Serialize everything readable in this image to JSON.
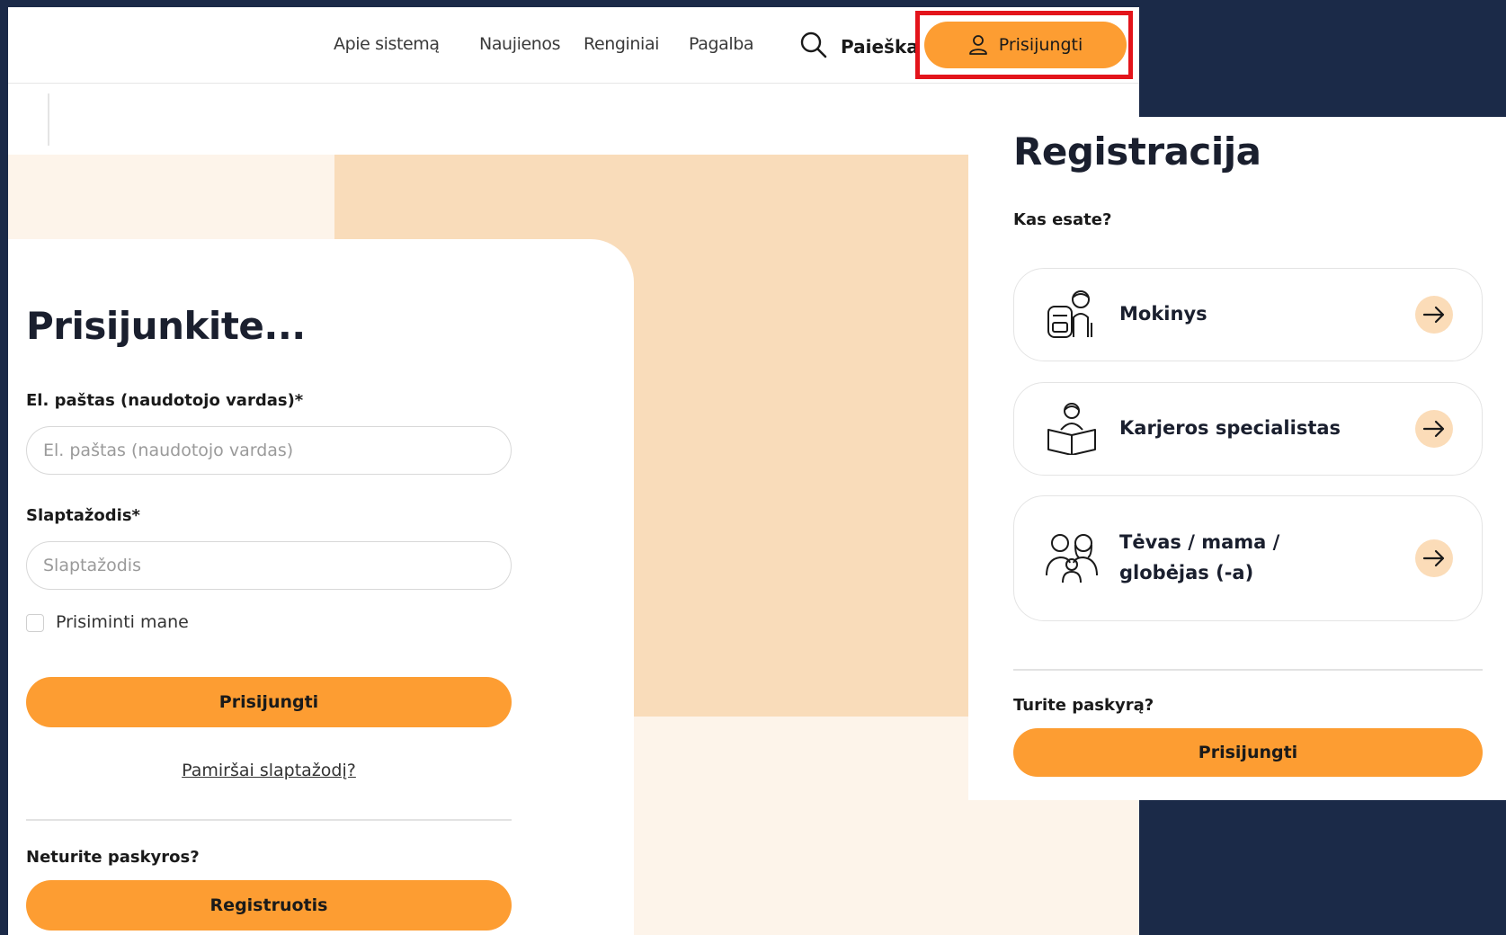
{
  "nav": {
    "links": [
      "Apie sistemą",
      "Naujienos",
      "Renginiai",
      "Pagalba"
    ],
    "search_label": "Paieška",
    "login_label": "Prisijungti"
  },
  "login": {
    "title": "Prisijunkite...",
    "email_label": "El. paštas (naudotojo vardas)*",
    "email_placeholder": "El. paštas (naudotojo vardas)",
    "password_label": "Slaptažodis*",
    "password_placeholder": "Slaptažodis",
    "remember_label": "Prisiminti mane",
    "submit_label": "Prisijungti",
    "forgot_label": "Pamiršai slaptažodį?",
    "no_account_label": "Neturite paskyros?",
    "register_label": "Registruotis"
  },
  "registration": {
    "title": "Registracija",
    "subtitle": "Kas esate?",
    "roles": [
      {
        "label": "Mokinys",
        "icon": "student-icon"
      },
      {
        "label": "Karjeros specialistas",
        "icon": "career-specialist-icon"
      },
      {
        "label_line1": "Tėvas / mama /",
        "label_line2": "globėjas (-a)",
        "icon": "parents-icon"
      }
    ],
    "have_account_label": "Turite paskyrą?",
    "login_label": "Prisijungti"
  },
  "colors": {
    "accent": "#fd9d32",
    "background_dark": "#1b2a48",
    "peach": "#f9dcba",
    "highlight": "#e3141b"
  }
}
